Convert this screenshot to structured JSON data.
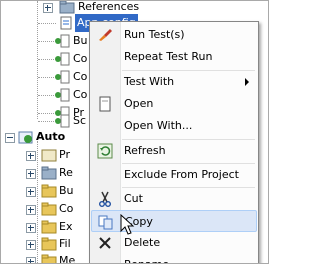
{
  "tree": {
    "references_label": "References",
    "selected_label": "App.config",
    "children_a": [
      "Bu",
      "Co",
      "Co",
      "Co",
      "Pr",
      "Sc"
    ],
    "section_label": "Auto",
    "children_b": [
      "Pr",
      "Re",
      "Bu",
      "Co",
      "Ex",
      "Fil",
      "Me"
    ]
  },
  "menu": {
    "run_tests": "Run Test(s)",
    "repeat_test_run": "Repeat Test Run",
    "test_with": "Test With",
    "open": "Open",
    "open_with": "Open With...",
    "refresh": "Refresh",
    "exclude_from_project": "Exclude From Project",
    "cut": "Cut",
    "copy": "Copy",
    "delete": "Delete",
    "rename": "Rename"
  }
}
